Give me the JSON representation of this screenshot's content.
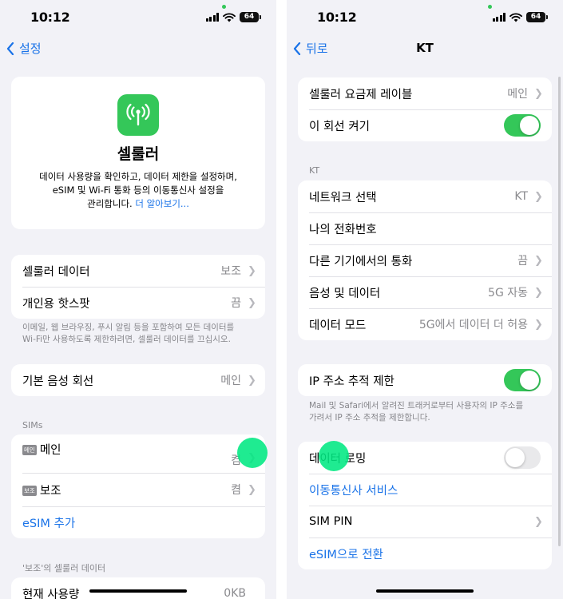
{
  "left": {
    "status": {
      "time": "10:12",
      "battery": "64"
    },
    "nav": {
      "back_label": "설정"
    },
    "hero": {
      "icon": "antenna-icon",
      "title": "셀룰러",
      "desc_line1": "데이터 사용량을 확인하고, 데이터 제한을 설정하며,",
      "desc_line2": "eSIM 및 Wi-Fi 통화 등의 이동통신사 설정을",
      "desc_line3": "관리합니다.",
      "learn_more": "더 알아보기..."
    },
    "group1": [
      {
        "label": "셀룰러 데이터",
        "value": "보조"
      },
      {
        "label": "개인용 핫스팟",
        "value": "끔"
      }
    ],
    "group1_footer_line1": "이메일, 웹 브라우징, 푸시 알림 등을 포함하여 모든 데이터를",
    "group1_footer_line2": "Wi-Fi만 사용하도록 제한하려면, 셀룰러 데이터를 끄십시오.",
    "voice_line": {
      "label": "기본 음성 회선",
      "value": "메인"
    },
    "sims_header": "SIMs",
    "sims": [
      {
        "badge": "메인",
        "label": "메인",
        "value": "켬"
      },
      {
        "badge": "보조",
        "label": "보조",
        "value": "켬"
      }
    ],
    "add_esim": "eSIM 추가",
    "usage_header": "'보조'의 셀룰러 데이터",
    "usage_row": {
      "label": "현재 사용량",
      "value": "0KB"
    }
  },
  "right": {
    "status": {
      "time": "10:12",
      "battery": "64"
    },
    "nav": {
      "back_label": "뒤로",
      "title": "KT"
    },
    "group1": {
      "plan_label": {
        "label": "셀룰러 요금제 레이블",
        "value": "메인"
      },
      "line_on": {
        "label": "이 회선 켜기",
        "state": true
      }
    },
    "kt_header": "KT",
    "group2": [
      {
        "label": "네트워크 선택",
        "value": "KT",
        "chevron": true
      },
      {
        "label": "나의 전화번호",
        "value": "",
        "chevron": false
      },
      {
        "label": "다른 기기에서의 통화",
        "value": "끔",
        "chevron": true
      },
      {
        "label": "음성 및 데이터",
        "value": "5G 자동",
        "chevron": true
      },
      {
        "label": "데이터 모드",
        "value": "5G에서 데이터 더 허용",
        "chevron": true
      }
    ],
    "ip_limit": {
      "label": "IP 주소 추적 제한",
      "state": true
    },
    "ip_footer_line1": "Mail 및 Safari에서 알려진 트래커로부터 사용자의 IP 주소를",
    "ip_footer_line2": "가려서 IP 주소 추적을 제한합니다.",
    "roaming": {
      "label": "데이터 로밍",
      "state": false
    },
    "carrier_services": "이동통신사 서비스",
    "sim_pin": "SIM PIN",
    "esim_convert": "eSIM으로 전환"
  },
  "colors": {
    "accent": "#1a73e8",
    "toggle_on": "#34c759",
    "touch": "#00e882"
  }
}
